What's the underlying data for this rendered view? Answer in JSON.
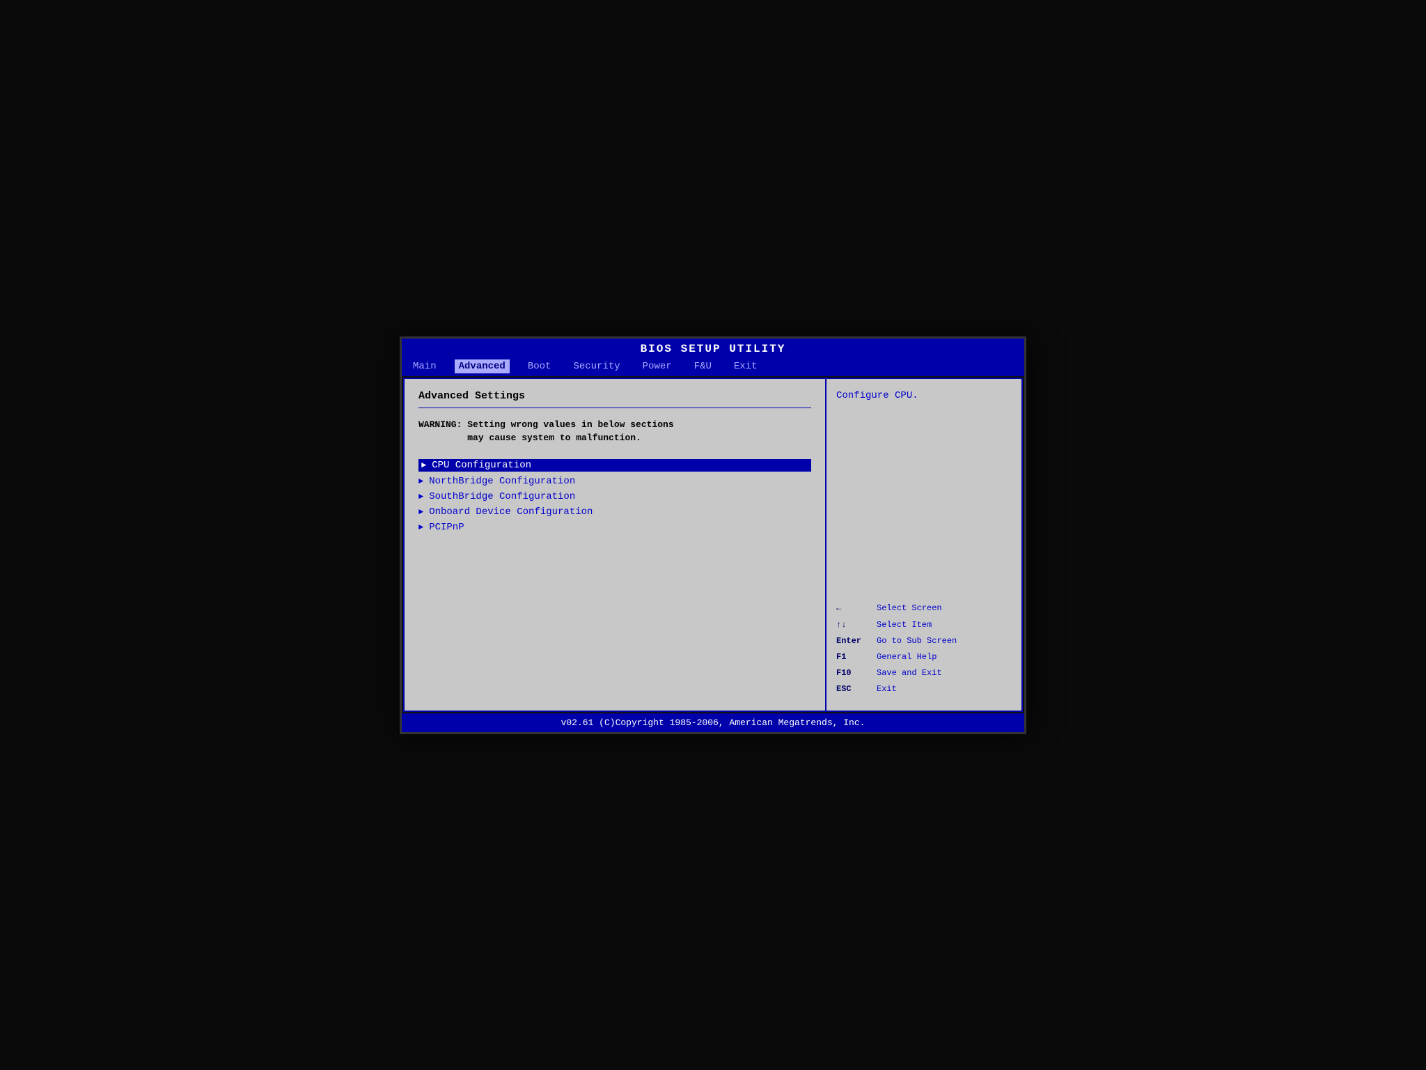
{
  "title": "BIOS SETUP UTILITY",
  "tabs": [
    {
      "label": "Main",
      "active": false
    },
    {
      "label": "Advanced",
      "active": true
    },
    {
      "label": "Boot",
      "active": false
    },
    {
      "label": "Security",
      "active": false
    },
    {
      "label": "Power",
      "active": false
    },
    {
      "label": "F&U",
      "active": false
    },
    {
      "label": "Exit",
      "active": false
    }
  ],
  "left_panel": {
    "section_title": "Advanced Settings",
    "warning": "WARNING: Setting wrong values in below sections\n         may cause system to malfunction.",
    "menu_items": [
      {
        "label": "CPU Configuration",
        "selected": true
      },
      {
        "label": "NorthBridge Configuration",
        "selected": false
      },
      {
        "label": "SouthBridge Configuration",
        "selected": false
      },
      {
        "label": "Onboard Device Configuration",
        "selected": false
      },
      {
        "label": "PCIPnP",
        "selected": false
      }
    ]
  },
  "right_panel": {
    "help_text": "Configure CPU.",
    "key_guide": [
      {
        "key": "←",
        "desc": "Select Screen"
      },
      {
        "key": "↑↓",
        "desc": "Select Item"
      },
      {
        "key": "Enter",
        "desc": "Go to Sub Screen"
      },
      {
        "key": "F1",
        "desc": "General Help"
      },
      {
        "key": "F10",
        "desc": "Save and Exit"
      },
      {
        "key": "ESC",
        "desc": "Exit"
      }
    ]
  },
  "footer": "v02.61 (C)Copyright 1985-2006, American Megatrends, Inc."
}
